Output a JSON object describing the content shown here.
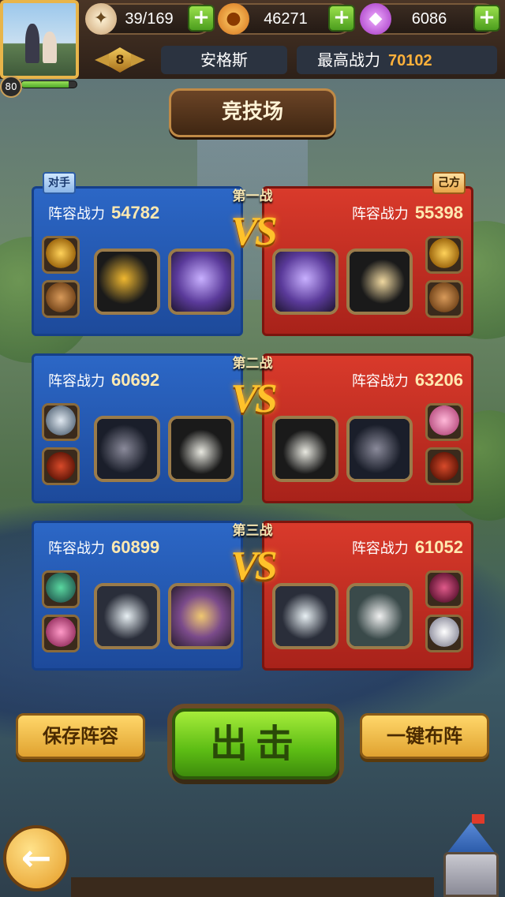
{
  "player": {
    "level": "80",
    "exp_fraction": 0.85,
    "rank": "8",
    "name": "安格斯",
    "max_power_label": "最高战力",
    "max_power_value": "70102"
  },
  "resources": [
    {
      "icon": "stamina-icon",
      "value": "39/169"
    },
    {
      "icon": "coin-icon",
      "value": "46271"
    },
    {
      "icon": "gem-icon",
      "value": "6086"
    }
  ],
  "page_title": "竞技场",
  "tags": {
    "opponent": "对手",
    "own": "己方"
  },
  "vs_text": "VS",
  "battles": [
    {
      "round": "第一战",
      "left": {
        "label": "阵容战力",
        "value": "54782"
      },
      "right": {
        "label": "阵容战力",
        "value": "55398"
      }
    },
    {
      "round": "第二战",
      "left": {
        "label": "阵容战力",
        "value": "60692"
      },
      "right": {
        "label": "阵容战力",
        "value": "63206"
      }
    },
    {
      "round": "第三战",
      "left": {
        "label": "阵容战力",
        "value": "60899"
      },
      "right": {
        "label": "阵容战力",
        "value": "61052"
      }
    }
  ],
  "buttons": {
    "save": "保存阵容",
    "attack": "出击",
    "auto": "一键布阵"
  },
  "colors": {
    "blue_team": "#2c67c6",
    "red_team": "#d93a2b",
    "power_value": "#ffb13a",
    "attack_button": "#5cbc14"
  }
}
